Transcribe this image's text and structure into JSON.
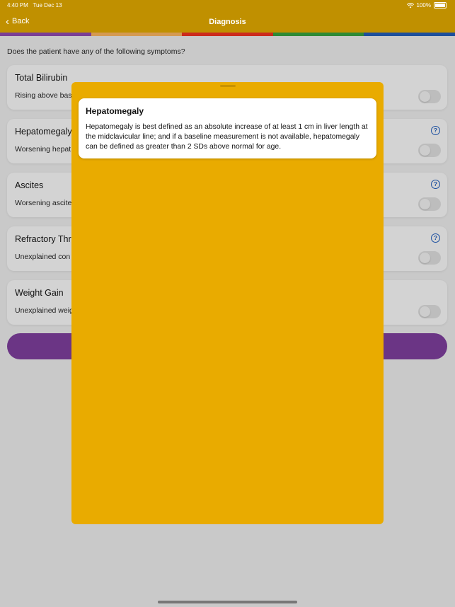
{
  "status_bar": {
    "time": "4:40 PM",
    "date": "Tue Dec 13",
    "battery": "100%"
  },
  "nav": {
    "back_label": "Back",
    "title": "Diagnosis"
  },
  "stripe_colors": [
    "#7a3f96",
    "#d49a52",
    "#cc2b1d",
    "#2e8a36",
    "#1d4f9c"
  ],
  "question": "Does the patient have any of the following symptoms?",
  "cards": [
    {
      "title": "Total Bilirubin",
      "subtitle": "Rising above bas",
      "has_help": false,
      "toggle": "off"
    },
    {
      "title": "Hepatomegaly",
      "subtitle": "Worsening hepat",
      "has_help": true,
      "toggle": "off"
    },
    {
      "title": "Ascites",
      "subtitle": "Worsening ascite",
      "has_help": true,
      "toggle": "off"
    },
    {
      "title": "Refractory Thr",
      "subtitle": "Unexplained con",
      "has_help": true,
      "toggle": "off"
    },
    {
      "title": "Weight Gain",
      "subtitle": "Unexplained weig",
      "has_help": false,
      "toggle": "off"
    }
  ],
  "icons": {
    "help": "?",
    "back": "‹"
  },
  "sheet": {
    "title": "Hepatomegaly",
    "body": "Hepatomegaly is best defined as an absolute increase of at least 1 cm in liver length at the midclavicular line; and if a baseline measurement is not available, hepatomegaly can be defined as greater than 2 SDs above normal for age."
  }
}
